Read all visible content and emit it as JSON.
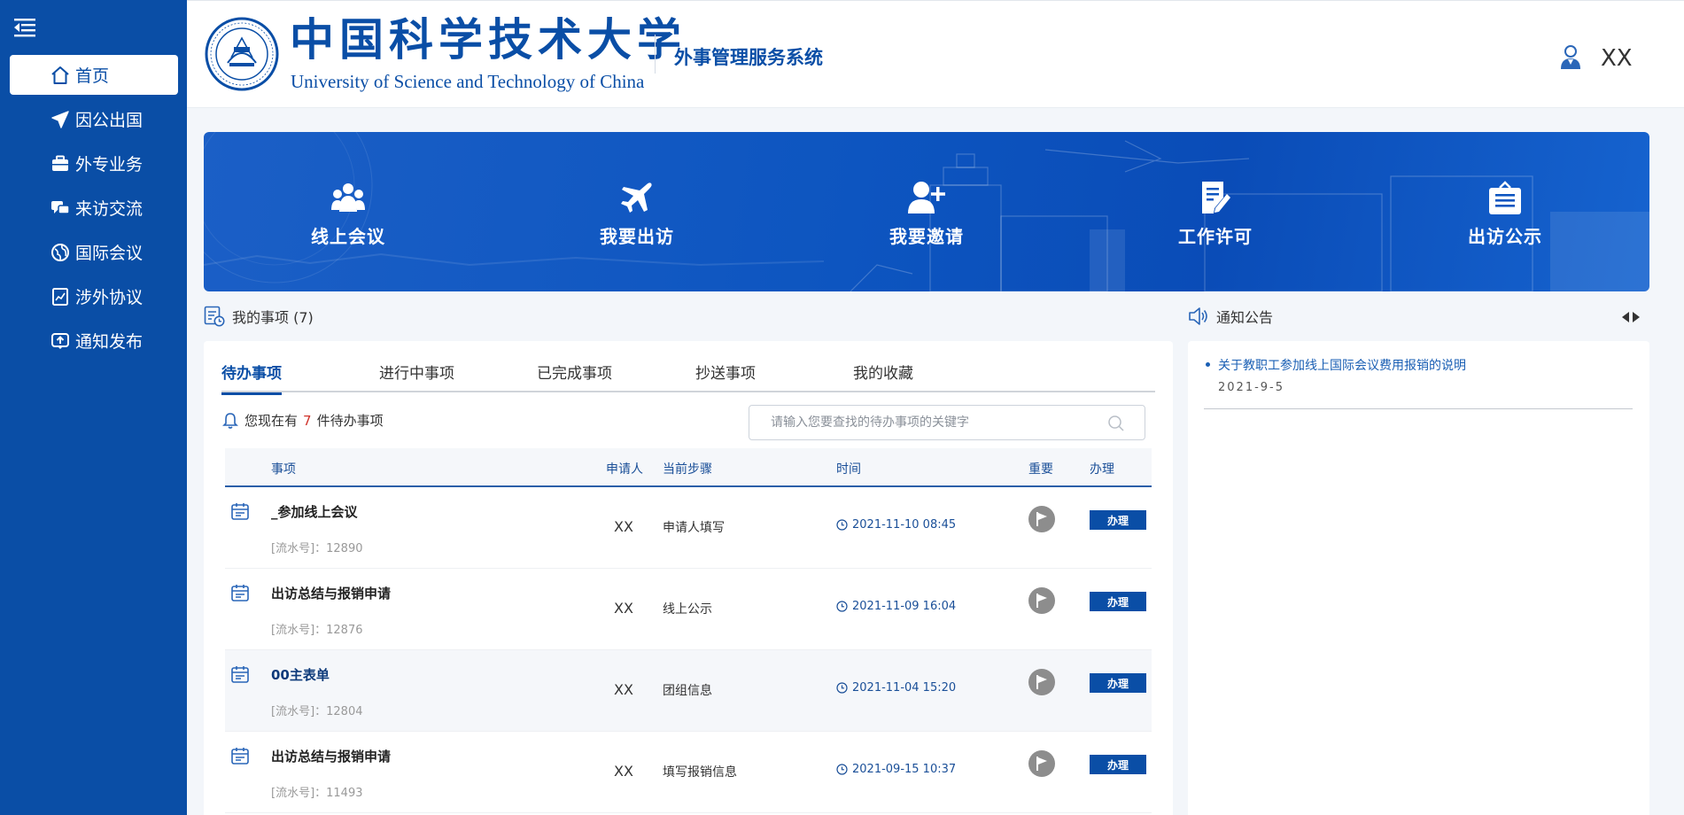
{
  "sidebar": {
    "items": [
      {
        "label": "首页",
        "icon": "home-icon",
        "active": true
      },
      {
        "label": "因公出国",
        "icon": "plane-icon"
      },
      {
        "label": "外专业务",
        "icon": "briefcase-icon"
      },
      {
        "label": "来访交流",
        "icon": "chat-icon"
      },
      {
        "label": "国际会议",
        "icon": "globe-icon"
      },
      {
        "label": "涉外协议",
        "icon": "agreement-icon"
      },
      {
        "label": "通知发布",
        "icon": "upload-icon"
      }
    ]
  },
  "header": {
    "university_cn": "中国科学技术大学",
    "university_en": "University of Science and Technology of China",
    "system_title": "外事管理服务系统",
    "user_name": "XX"
  },
  "shortcuts": [
    {
      "label": "线上会议",
      "icon": "group-icon"
    },
    {
      "label": "我要出访",
      "icon": "plane-icon"
    },
    {
      "label": "我要邀请",
      "icon": "add-user-icon"
    },
    {
      "label": "工作许可",
      "icon": "edit-document-icon"
    },
    {
      "label": "出访公示",
      "icon": "notice-board-icon"
    }
  ],
  "my_items": {
    "title": "我的事项 (7)",
    "tabs": [
      "待办事项",
      "进行中事项",
      "已完成事项",
      "抄送事项",
      "我的收藏"
    ],
    "active_tab": 0,
    "pending_prefix": "您现在有",
    "pending_count": "7",
    "pending_suffix": "件待办事项",
    "search_placeholder": "请输入您要查找的待办事项的关键字",
    "columns": [
      "事项",
      "申请人",
      "当前步骤",
      "时间",
      "重要",
      "办理"
    ],
    "rows": [
      {
        "title": "_参加线上会议",
        "serial": "[流水号]：12890",
        "applicant": "XX",
        "step": "申请人填写",
        "time": "2021-11-10 08:45",
        "action": "办理"
      },
      {
        "title": "出访总结与报销申请",
        "serial": "[流水号]：12876",
        "applicant": "XX",
        "step": "线上公示",
        "time": "2021-11-09 16:04",
        "action": "办理"
      },
      {
        "title": "00主表单",
        "serial": "[流水号]：12804",
        "applicant": "XX",
        "step": "团组信息",
        "time": "2021-11-04 15:20",
        "action": "办理"
      },
      {
        "title": "出访总结与报销申请",
        "serial": "[流水号]：11493",
        "applicant": "XX",
        "step": "填写报销信息",
        "time": "2021-09-15 10:37",
        "action": "办理"
      }
    ]
  },
  "notices": {
    "title": "通知公告",
    "items": [
      {
        "title": "关于教职工参加线上国际会议费用报销的说明",
        "date": "2021-9-5"
      }
    ]
  },
  "colors": {
    "primary": "#0a4ea6",
    "accent_red": "#d0342c",
    "flag_gray": "#8d8d8d"
  }
}
